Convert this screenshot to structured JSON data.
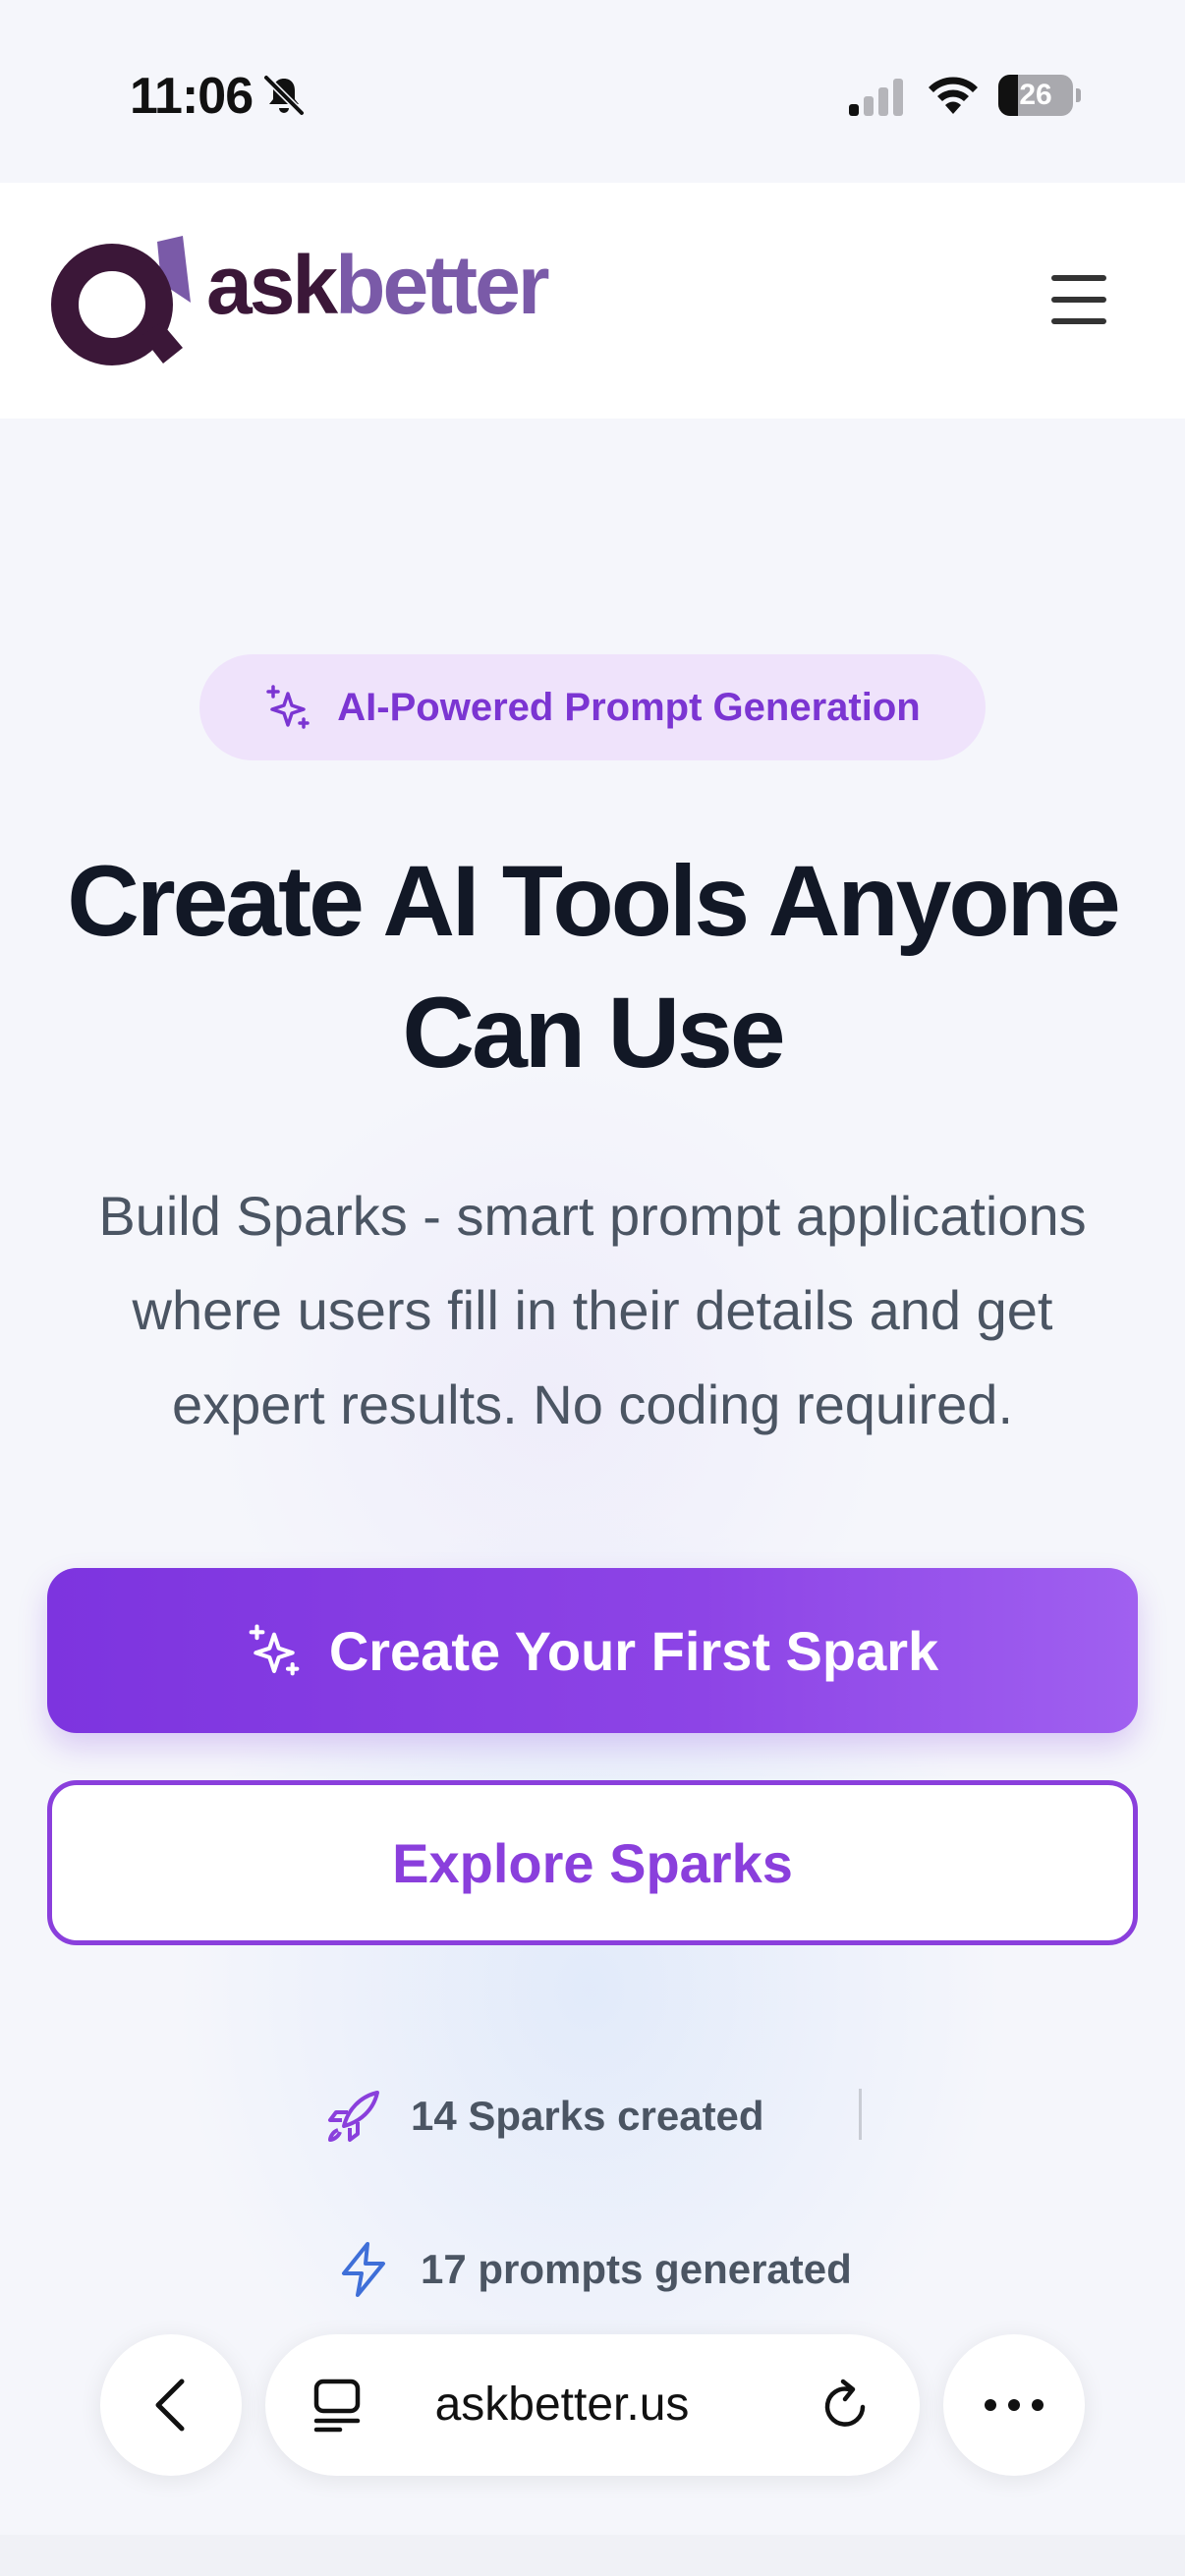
{
  "status_bar": {
    "time": "11:06",
    "battery": "26",
    "battery_level": 0.26
  },
  "header": {
    "logo_ask": "ask",
    "logo_better": "better"
  },
  "hero": {
    "badge": "AI-Powered Prompt Generation",
    "title_line1": "Create AI Tools Anyone",
    "title_line2": "Can Use",
    "subtitle": "Build Sparks - smart prompt applications where users fill in their details and get expert results. No coding required."
  },
  "cta": {
    "primary": "Create Your First Spark",
    "secondary": "Explore Sparks"
  },
  "stats": {
    "sparks": "14 Sparks created",
    "prompts": "17 prompts generated"
  },
  "browser": {
    "url": "askbetter.us"
  },
  "colors": {
    "accent": "#8a3fdc",
    "badge_bg": "#efe3fb",
    "logo_dark": "#3b1738",
    "logo_light": "#7a5aa8",
    "bolt": "#3f6fd8"
  }
}
